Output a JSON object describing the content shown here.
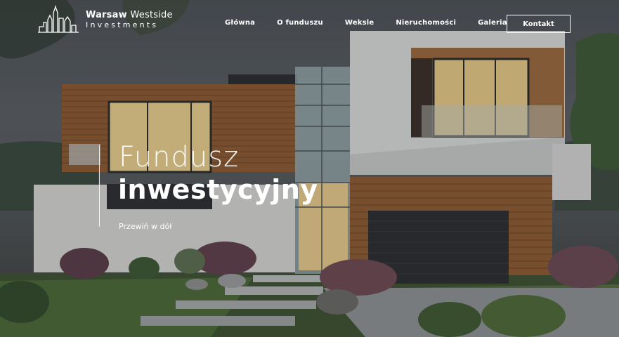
{
  "brand": {
    "name_bold": "Warsaw",
    "name_light": "Westside",
    "subtitle": "Investments"
  },
  "nav": {
    "items": [
      "Główna",
      "O funduszu",
      "Weksle",
      "Nieruchomości",
      "Galeria"
    ],
    "contact": "Kontakt"
  },
  "hero": {
    "line1": "Fundusz",
    "line2": "inwestycyjny",
    "scroll": "Przewiń w dół"
  },
  "colors": {
    "text": "#ffffff",
    "wood": "#8a5a32",
    "wall": "#d9d9d6",
    "glass_light": "#f2d89a"
  },
  "icons": [
    "city-skyline-logo-icon"
  ]
}
